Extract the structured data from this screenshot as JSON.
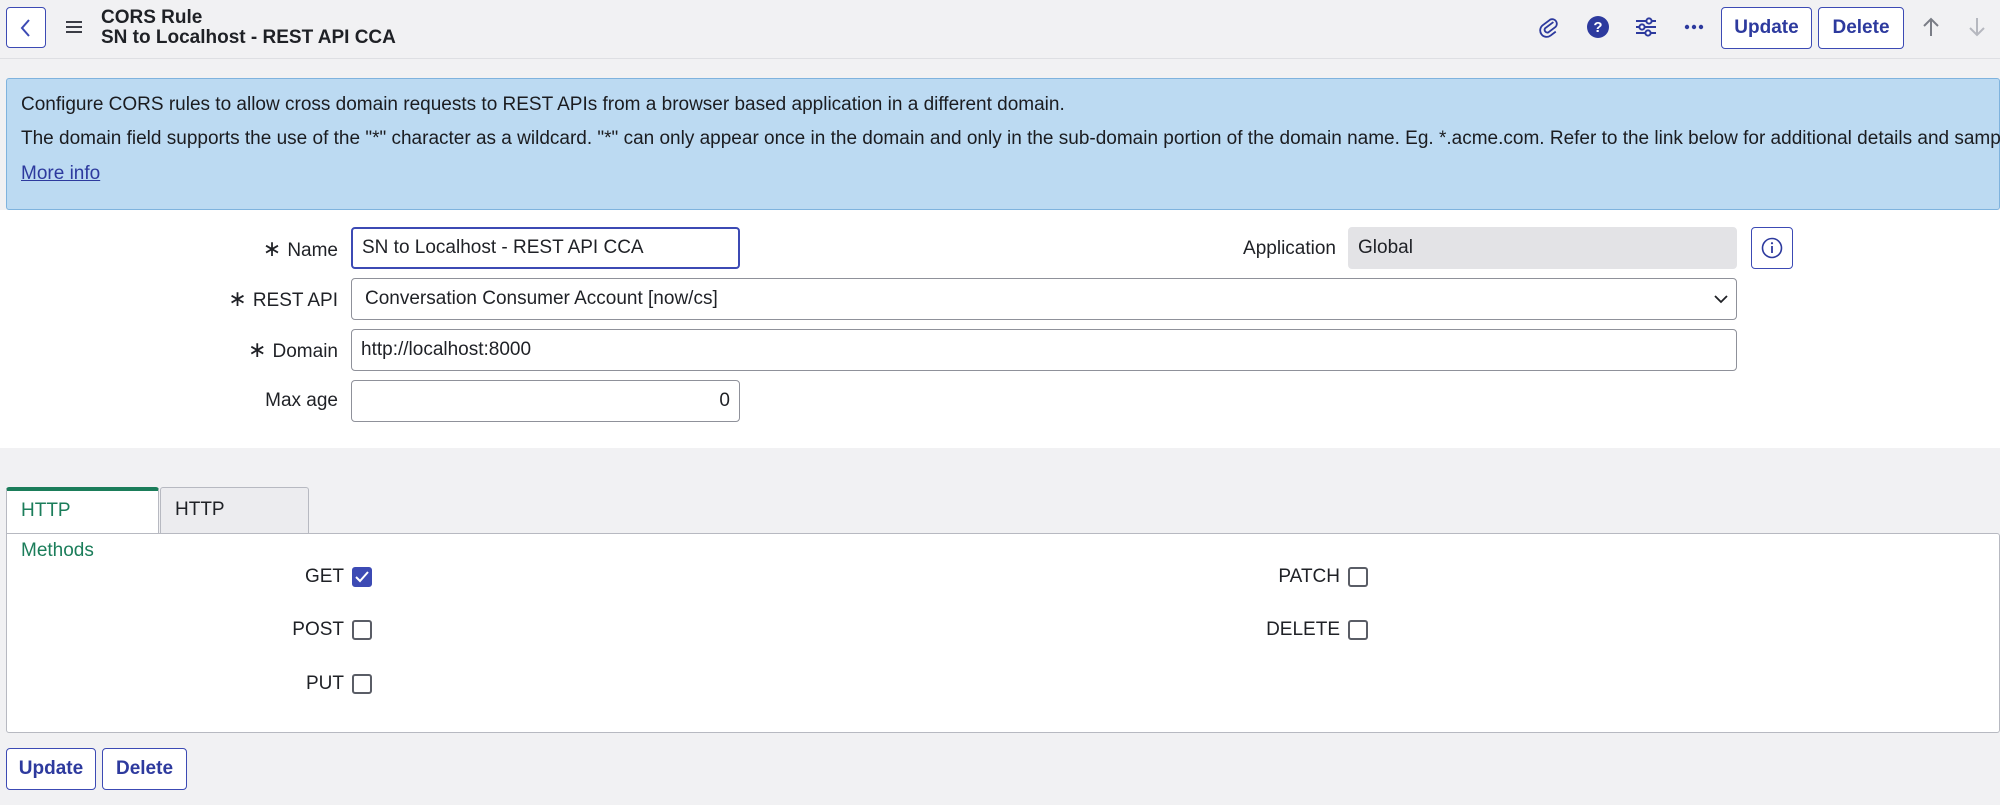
{
  "header": {
    "title": "CORS Rule",
    "subtitle": "SN to Localhost - REST API CCA",
    "update_label": "Update",
    "delete_label": "Delete"
  },
  "info": {
    "line1": "Configure CORS rules to allow cross domain requests to REST APIs from a browser based application in a different domain.",
    "line2": "The domain field supports the use of the \"*\" character as a wildcard. \"*\" can only appear once in the domain and only in the sub-domain portion of the domain name. Eg. *.acme.com. Refer to the link below for additional details and samples.",
    "more_info": "More info"
  },
  "form": {
    "name_label": "Name",
    "name_value": "SN to Localhost - REST API CCA",
    "application_label": "Application",
    "application_value": "Global",
    "rest_api_label": "REST API",
    "rest_api_value": "Conversation Consumer Account [now/cs]",
    "domain_label": "Domain",
    "domain_value": "http://localhost:8000",
    "max_age_label": "Max age",
    "max_age_value": "0"
  },
  "tabs": [
    {
      "label": "HTTP Methods",
      "active": true
    },
    {
      "label": "HTTP Headers",
      "active": false
    }
  ],
  "methods": {
    "get": {
      "label": "GET",
      "checked": true
    },
    "post": {
      "label": "POST",
      "checked": false
    },
    "put": {
      "label": "PUT",
      "checked": false
    },
    "patch": {
      "label": "PATCH",
      "checked": false
    },
    "delete": {
      "label": "DELETE",
      "checked": false
    }
  },
  "footer": {
    "update_label": "Update",
    "delete_label": "Delete"
  },
  "colors": {
    "accent": "#3c4ab4",
    "banner": "#bcdaf2",
    "active_tab": "#1b7d5a"
  }
}
